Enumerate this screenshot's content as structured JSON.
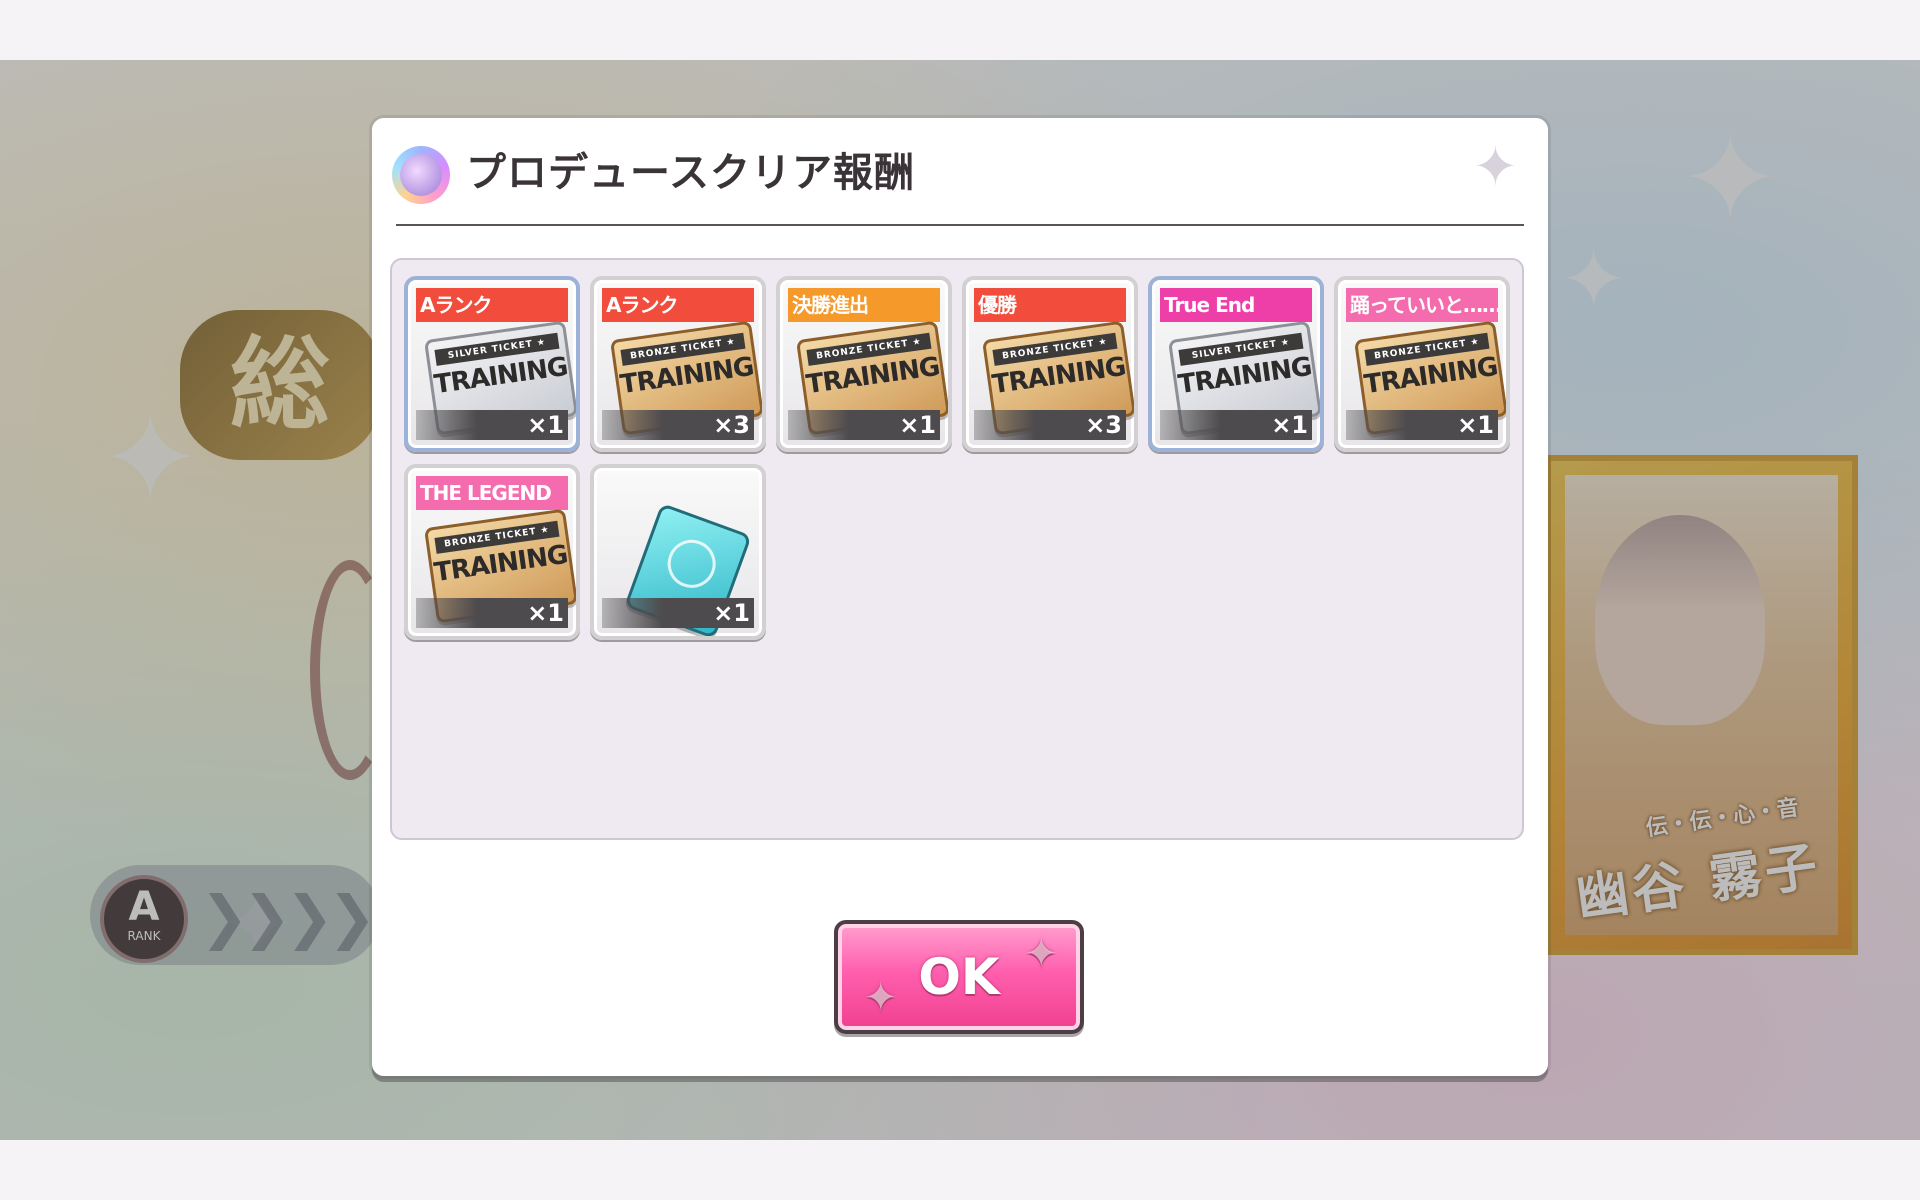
{
  "background": {
    "emblem_char": "総",
    "rank_letter": "A",
    "rank_word": "RANK",
    "chevrons": "❯❯❯❯",
    "card_subtitle": "伝・伝・心・音",
    "card_name": "幽谷 霧子"
  },
  "dialog": {
    "title": "プロデュースクリア報酬",
    "ok_label": "OK",
    "rewards": [
      {
        "label": "Aランク",
        "label_color": "#f24c3c",
        "item": "silver-ticket",
        "ticket_kind": "SILVER TICKET ★",
        "ticket_word": "TRAINING",
        "qty": "×1"
      },
      {
        "label": "Aランク",
        "label_color": "#f24c3c",
        "item": "bronze-ticket",
        "ticket_kind": "BRONZE TICKET ★",
        "ticket_word": "TRAINING",
        "qty": "×3"
      },
      {
        "label": "決勝進出",
        "label_color": "#f59a2a",
        "item": "bronze-ticket",
        "ticket_kind": "BRONZE TICKET ★",
        "ticket_word": "TRAINING",
        "qty": "×1"
      },
      {
        "label": "優勝",
        "label_color": "#f24c3c",
        "item": "bronze-ticket",
        "ticket_kind": "BRONZE TICKET ★",
        "ticket_word": "TRAINING",
        "qty": "×3"
      },
      {
        "label": "True End",
        "label_color": "#ee3fa8",
        "item": "silver-ticket",
        "ticket_kind": "SILVER TICKET ★",
        "ticket_word": "TRAINING",
        "qty": "×1"
      },
      {
        "label": "踊っていいと……",
        "label_color": "#f46cad",
        "item": "bronze-ticket",
        "ticket_kind": "BRONZE TICKET ★",
        "ticket_word": "TRAINING",
        "qty": "×1"
      },
      {
        "label": "THE LEGEND",
        "label_color": "#f46cad",
        "item": "bronze-ticket",
        "ticket_kind": "BRONZE TICKET ★",
        "ticket_word": "TRAINING",
        "qty": "×1"
      },
      {
        "label": "",
        "label_color": "",
        "item": "notebook",
        "ticket_kind": "",
        "ticket_word": "",
        "qty": "×1"
      }
    ]
  },
  "colors": {
    "ok_button": "#ff5fae",
    "panel_bg": "#efe9f1",
    "dialog_bg": "#ffffff"
  }
}
